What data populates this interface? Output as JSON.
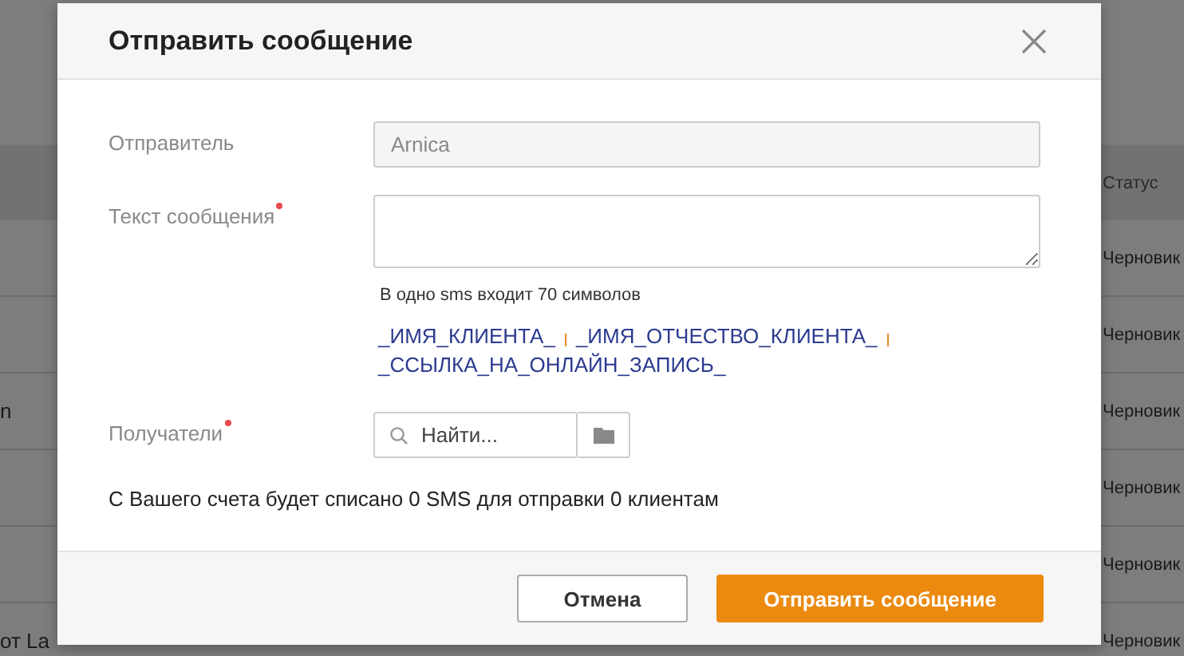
{
  "background": {
    "status_header": "Статус",
    "rows": [
      {
        "status": "Черновик"
      },
      {
        "status": "Черновик"
      },
      {
        "name": "n",
        "status": "Черновик"
      },
      {
        "status": "Черновик"
      },
      {
        "status": "Черновик"
      },
      {
        "name": "от La",
        "status": "Черновик"
      }
    ]
  },
  "dialog": {
    "title": "Отправить сообщение",
    "sender": {
      "label": "Отправитель",
      "value": "Arnica",
      "disabled": true
    },
    "message": {
      "label": "Текст сообщения",
      "required": true,
      "hint": "В одно sms входит 70 символов"
    },
    "variables": [
      "_ИМЯ_КЛИЕНТА_",
      "_ИМЯ_ОТЧЕСТВО_КЛИЕНТА_",
      "_ССЫЛКА_НА_ОНЛАЙН_ЗАПИСЬ_"
    ],
    "recipients": {
      "label": "Получатели",
      "required": true,
      "placeholder": "Найти..."
    },
    "summary": "С Вашего счета будет списано 0 SMS для отправки 0 клиентам",
    "buttons": [
      {
        "label": "Отмена",
        "kind": "secondary"
      },
      {
        "label": "Отправить сообщение",
        "kind": "primary"
      }
    ]
  }
}
